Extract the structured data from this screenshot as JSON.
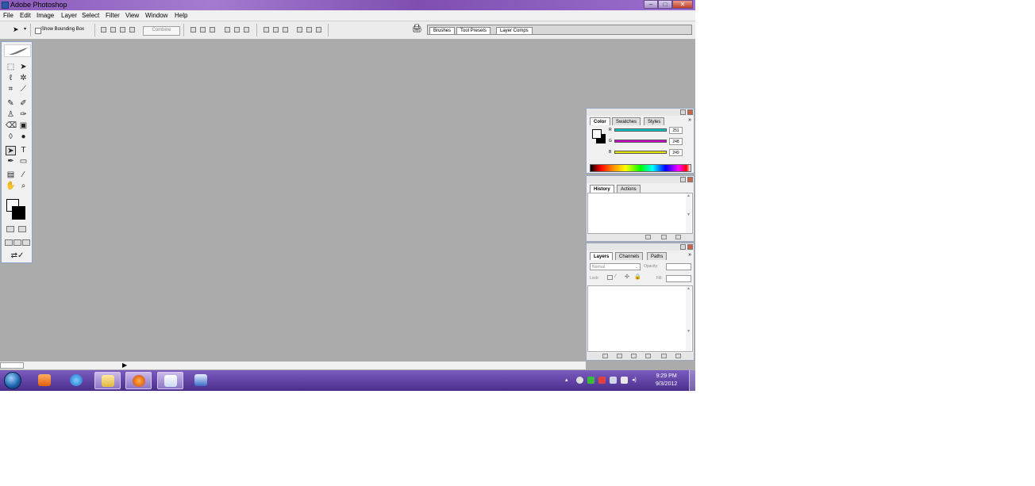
{
  "window": {
    "title": "Adobe Photoshop",
    "min_label": "–",
    "max_label": "□",
    "close_label": "✕"
  },
  "menu": [
    "File",
    "Edit",
    "Image",
    "Layer",
    "Select",
    "Filter",
    "View",
    "Window",
    "Help"
  ],
  "options": {
    "show_bounding_box_label": "Show Bounding Box",
    "combine_label": "Combine",
    "well_tabs": [
      "Brushes",
      "Tool Presets",
      "Layer Comps"
    ]
  },
  "color_palette": {
    "tabs": [
      "Color",
      "Swatches",
      "Styles"
    ],
    "menu_label": "»",
    "channels": [
      {
        "label": "R",
        "value": "251",
        "color": "#00c8c8"
      },
      {
        "label": "G",
        "value": "248",
        "color": "#c800c8"
      },
      {
        "label": "B",
        "value": "249",
        "color": "#e6e600"
      }
    ]
  },
  "history_palette": {
    "tabs": [
      "History",
      "Actions"
    ]
  },
  "layers_palette": {
    "tabs": [
      "Layers",
      "Channels",
      "Paths"
    ],
    "menu_label": "»",
    "blend_mode": "Normal",
    "opacity_label": "Opacity:",
    "lock_label": "Lock:",
    "fill_label": "Fill:"
  },
  "tools": {
    "type_tool_label": "T"
  },
  "taskbar": {
    "clock_time": "9:29 PM",
    "clock_date": "9/3/2012",
    "accent": "#5a3a9e"
  }
}
